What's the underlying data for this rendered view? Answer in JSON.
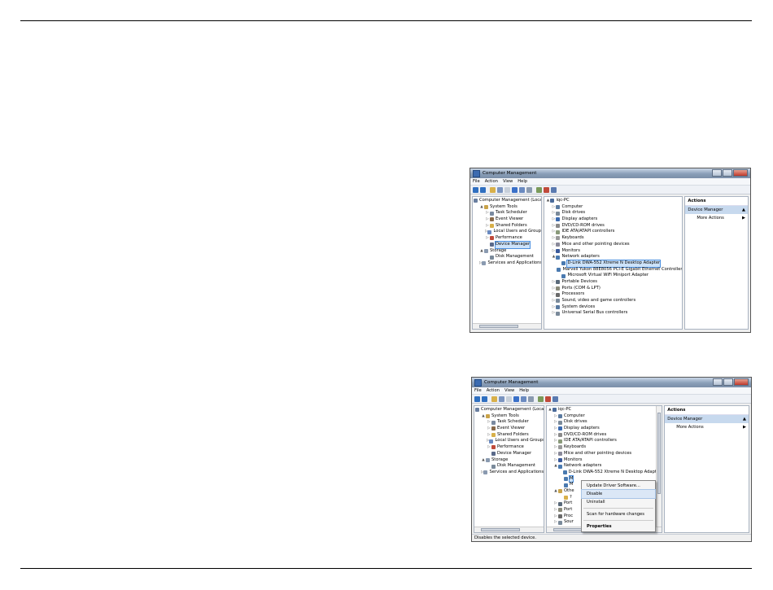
{
  "window": {
    "title": "Computer Management",
    "menu": [
      "File",
      "Action",
      "View",
      "Help"
    ]
  },
  "left_tree": [
    {
      "label": "Computer Management (Local)",
      "indent": 0,
      "exp": "",
      "color": "#6a7fa0"
    },
    {
      "label": "System Tools",
      "indent": 1,
      "exp": "▲",
      "color": "#c9a34a"
    },
    {
      "label": "Task Scheduler",
      "indent": 2,
      "exp": "▷",
      "color": "#7a8aa0"
    },
    {
      "label": "Event Viewer",
      "indent": 2,
      "exp": "▷",
      "color": "#8a6a4a"
    },
    {
      "label": "Shared Folders",
      "indent": 2,
      "exp": "▷",
      "color": "#d8b04a"
    },
    {
      "label": "Local Users and Groups",
      "indent": 2,
      "exp": "▷",
      "color": "#6a8ac0"
    },
    {
      "label": "Performance",
      "indent": 2,
      "exp": "▷",
      "color": "#c04a3a"
    },
    {
      "label": "Device Manager",
      "indent": 2,
      "exp": "",
      "color": "#5a6a8a"
    },
    {
      "label": "Storage",
      "indent": 1,
      "exp": "▲",
      "color": "#8a9ab0"
    },
    {
      "label": "Disk Management",
      "indent": 2,
      "exp": "",
      "color": "#7a8a9a"
    },
    {
      "label": "Services and Applications",
      "indent": 1,
      "exp": "▷",
      "color": "#8a9ab0"
    }
  ],
  "device_tree_1": [
    {
      "label": "iqc-PC",
      "indent": 0,
      "exp": "▲",
      "color": "#4a6a9a"
    },
    {
      "label": "Computer",
      "indent": 1,
      "exp": "▷",
      "color": "#5a7aa0"
    },
    {
      "label": "Disk drives",
      "indent": 1,
      "exp": "▷",
      "color": "#7a8a9a"
    },
    {
      "label": "Display adapters",
      "indent": 1,
      "exp": "▷",
      "color": "#3a6ab0"
    },
    {
      "label": "DVD/CD-ROM drives",
      "indent": 1,
      "exp": "▷",
      "color": "#8a8a8a"
    },
    {
      "label": "IDE ATA/ATAPI controllers",
      "indent": 1,
      "exp": "▷",
      "color": "#8a9a7a"
    },
    {
      "label": "Keyboards",
      "indent": 1,
      "exp": "▷",
      "color": "#9a9a9a"
    },
    {
      "label": "Mice and other pointing devices",
      "indent": 1,
      "exp": "▷",
      "color": "#8a8a9a"
    },
    {
      "label": "Monitors",
      "indent": 1,
      "exp": "▷",
      "color": "#3a5a9a"
    },
    {
      "label": "Network adapters",
      "indent": 1,
      "exp": "▲",
      "color": "#4a7ab0"
    },
    {
      "label": "D-Link DWA-552 Xtreme N Desktop Adapter",
      "indent": 2,
      "exp": "",
      "color": "#4a7ab0",
      "selected": true
    },
    {
      "label": "Marvell Yukon 88E8056 PCI-E Gigabit Ethernet Controller",
      "indent": 2,
      "exp": "",
      "color": "#4a7ab0"
    },
    {
      "label": "Microsoft Virtual WiFi Miniport Adapter",
      "indent": 2,
      "exp": "",
      "color": "#4a7ab0"
    },
    {
      "label": "Portable Devices",
      "indent": 1,
      "exp": "▷",
      "color": "#5a6a7a"
    },
    {
      "label": "Ports (COM & LPT)",
      "indent": 1,
      "exp": "▷",
      "color": "#8a8a7a"
    },
    {
      "label": "Processors",
      "indent": 1,
      "exp": "▷",
      "color": "#6a6a6a"
    },
    {
      "label": "Sound, video and game controllers",
      "indent": 1,
      "exp": "▷",
      "color": "#7a8a9a"
    },
    {
      "label": "System devices",
      "indent": 1,
      "exp": "▷",
      "color": "#5a7aa0"
    },
    {
      "label": "Universal Serial Bus controllers",
      "indent": 1,
      "exp": "▷",
      "color": "#7a8a9a"
    }
  ],
  "device_tree_2": [
    {
      "label": "iqc-PC",
      "indent": 0,
      "exp": "▲",
      "color": "#4a6a9a"
    },
    {
      "label": "Computer",
      "indent": 1,
      "exp": "▷",
      "color": "#5a7aa0"
    },
    {
      "label": "Disk drives",
      "indent": 1,
      "exp": "▷",
      "color": "#7a8a9a"
    },
    {
      "label": "Display adapters",
      "indent": 1,
      "exp": "▷",
      "color": "#3a6ab0"
    },
    {
      "label": "DVD/CD-ROM drives",
      "indent": 1,
      "exp": "▷",
      "color": "#8a8a8a"
    },
    {
      "label": "IDE ATA/ATAPI controllers",
      "indent": 1,
      "exp": "▷",
      "color": "#8a9a7a"
    },
    {
      "label": "Keyboards",
      "indent": 1,
      "exp": "▷",
      "color": "#9a9a9a"
    },
    {
      "label": "Mice and other pointing devices",
      "indent": 1,
      "exp": "▷",
      "color": "#8a8a9a"
    },
    {
      "label": "Monitors",
      "indent": 1,
      "exp": "▷",
      "color": "#3a5a9a"
    },
    {
      "label": "Network adapters",
      "indent": 1,
      "exp": "▲",
      "color": "#4a7ab0"
    },
    {
      "label": "D-Link DWA-552 Xtreme N Desktop Adapter",
      "indent": 2,
      "exp": "",
      "color": "#4a7ab0"
    },
    {
      "label": "M",
      "indent": 2,
      "exp": "",
      "color": "#4a7ab0",
      "selected": true
    },
    {
      "label": "M",
      "indent": 2,
      "exp": "",
      "color": "#4a7ab0"
    },
    {
      "label": "Othe",
      "indent": 1,
      "exp": "▲",
      "color": "#c9a34a"
    },
    {
      "label": "?",
      "indent": 2,
      "exp": "",
      "color": "#d8b04a"
    },
    {
      "label": "Port",
      "indent": 1,
      "exp": "▷",
      "color": "#5a6a7a"
    },
    {
      "label": "Port",
      "indent": 1,
      "exp": "▷",
      "color": "#8a8a7a"
    },
    {
      "label": "Proc",
      "indent": 1,
      "exp": "▷",
      "color": "#6a6a6a"
    },
    {
      "label": "Sour",
      "indent": 1,
      "exp": "▷",
      "color": "#7a8a9a"
    }
  ],
  "actions": {
    "header": "Actions",
    "section": "Device Manager",
    "more": "More Actions"
  },
  "context_menu": [
    "Update Driver Software...",
    "Disable",
    "Uninstall",
    "Scan for hardware changes",
    "Properties"
  ],
  "status_text": "Disables the selected device.",
  "toolbar_colors": [
    "#2f6fc0",
    "#2f6fc0",
    "#d8b04a",
    "#7a94c0",
    "#c8d0da",
    "#3a70c8",
    "#6a8ac0",
    "#8a9ab0",
    "#7a9a5a",
    "#c04a3a",
    "#5a7ab0"
  ]
}
